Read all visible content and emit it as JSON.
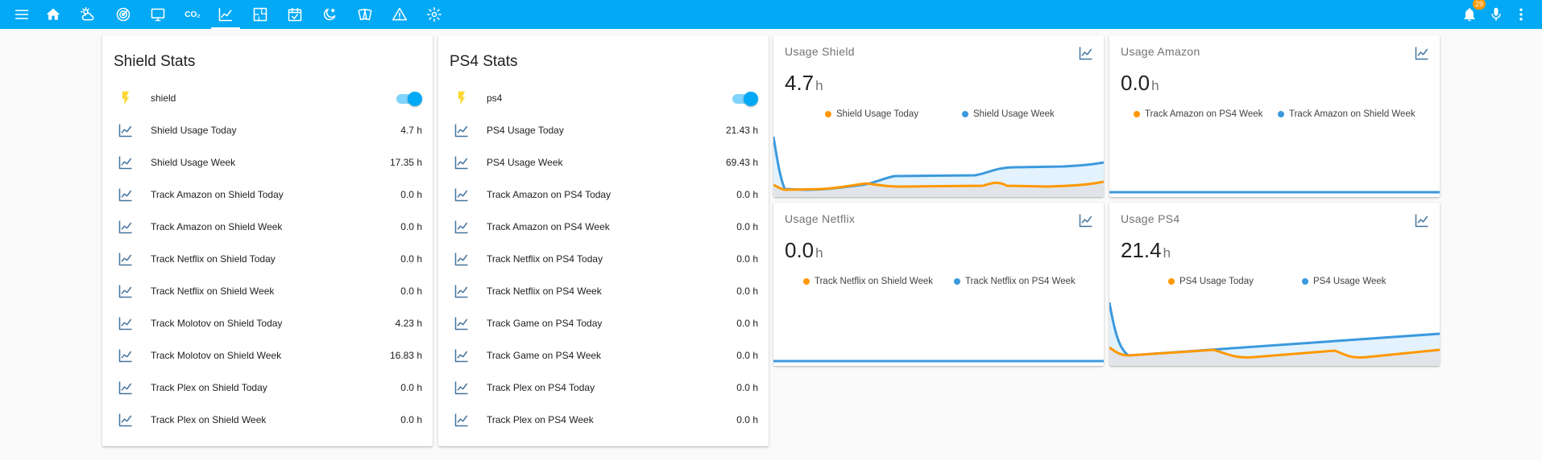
{
  "colors": {
    "accent": "#03a9f4",
    "orange": "#ff9800",
    "blue": "#3b99dd",
    "icon_blue": "#44739e",
    "bolt": "#fdd835"
  },
  "toolbar": {
    "menu_icon": "menu-icon",
    "views": [
      {
        "icon": "home-icon"
      },
      {
        "icon": "weather-icon"
      },
      {
        "icon": "radar-icon"
      },
      {
        "icon": "monitor-icon"
      },
      {
        "icon": "co2-icon",
        "text": "CO₂"
      },
      {
        "icon": "chart-line-icon",
        "active": true
      },
      {
        "icon": "floor-plan-icon"
      },
      {
        "icon": "calendar-icon"
      },
      {
        "icon": "moon-star-icon"
      },
      {
        "icon": "cards-icon"
      },
      {
        "icon": "alert-icon"
      },
      {
        "icon": "settings-icon"
      }
    ],
    "notifications_count": "29"
  },
  "cards": {
    "shield": {
      "title": "Shield Stats",
      "switch": {
        "label": "shield",
        "on": true
      },
      "rows": [
        {
          "name": "Shield Usage Today",
          "value": "4.7 h"
        },
        {
          "name": "Shield Usage Week",
          "value": "17.35 h"
        },
        {
          "name": "Track Amazon on Shield Today",
          "value": "0.0 h"
        },
        {
          "name": "Track Amazon on Shield Week",
          "value": "0.0 h"
        },
        {
          "name": "Track Netflix on Shield Today",
          "value": "0.0 h"
        },
        {
          "name": "Track Netflix on Shield Week",
          "value": "0.0 h"
        },
        {
          "name": "Track Molotov on Shield Today",
          "value": "4.23 h"
        },
        {
          "name": "Track Molotov on Shield Week",
          "value": "16.83 h"
        },
        {
          "name": "Track Plex on Shield Today",
          "value": "0.0 h"
        },
        {
          "name": "Track Plex on Shield Week",
          "value": "0.0 h"
        }
      ]
    },
    "ps4": {
      "title": "PS4 Stats",
      "switch": {
        "label": "ps4",
        "on": true
      },
      "rows": [
        {
          "name": "PS4 Usage Today",
          "value": "21.43 h"
        },
        {
          "name": "PS4 Usage Week",
          "value": "69.43 h"
        },
        {
          "name": "Track Amazon on PS4 Today",
          "value": "0.0 h"
        },
        {
          "name": "Track Amazon on PS4 Week",
          "value": "0.0 h"
        },
        {
          "name": "Track Netflix on PS4 Today",
          "value": "0.0 h"
        },
        {
          "name": "Track Netflix on PS4 Week",
          "value": "0.0 h"
        },
        {
          "name": "Track Game on PS4 Today",
          "value": "0.0 h"
        },
        {
          "name": "Track Game on PS4 Week",
          "value": "0.0 h"
        },
        {
          "name": "Track Plex on PS4 Today",
          "value": "0.0 h"
        },
        {
          "name": "Track Plex on PS4 Week",
          "value": "0.0 h"
        }
      ]
    }
  },
  "graphs": {
    "shield": {
      "title": "Usage Shield",
      "value": "4.7",
      "unit": "h",
      "legend": [
        "Shield Usage Today",
        "Shield Usage Week"
      ]
    },
    "amazon": {
      "title": "Usage Amazon",
      "value": "0.0",
      "unit": "h",
      "legend": [
        "Track Amazon on PS4 Week",
        "Track Amazon on Shield Week"
      ]
    },
    "netflix": {
      "title": "Usage Netflix",
      "value": "0.0",
      "unit": "h",
      "legend": [
        "Track Netflix on Shield Week",
        "Track Netflix on PS4 Week"
      ]
    },
    "ps4": {
      "title": "Usage PS4",
      "value": "21.4",
      "unit": "h",
      "legend": [
        "PS4 Usage Today",
        "PS4 Usage Week"
      ]
    }
  }
}
